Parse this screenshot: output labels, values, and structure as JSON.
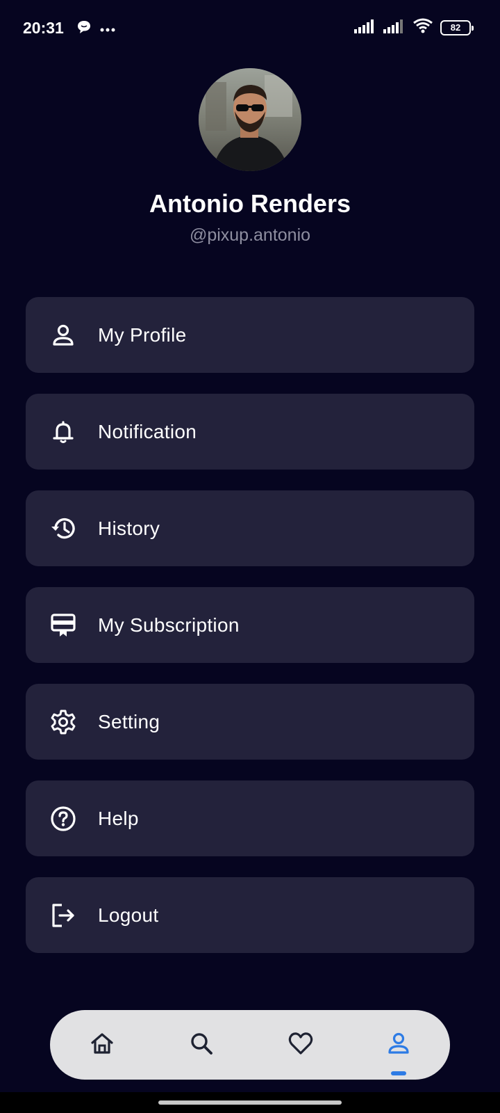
{
  "status_bar": {
    "time": "20:31",
    "battery": "82"
  },
  "profile": {
    "name": "Antonio Renders",
    "handle": "@pixup.antonio"
  },
  "menu": {
    "items": [
      {
        "label": "My Profile",
        "icon": "user-icon"
      },
      {
        "label": "Notification",
        "icon": "bell-icon"
      },
      {
        "label": "History",
        "icon": "history-icon"
      },
      {
        "label": "My Subscription",
        "icon": "subscription-icon"
      },
      {
        "label": "Setting",
        "icon": "gear-icon"
      },
      {
        "label": "Help",
        "icon": "help-icon"
      },
      {
        "label": "Logout",
        "icon": "logout-icon"
      }
    ]
  },
  "bottom_nav": {
    "items": [
      {
        "icon": "home-icon",
        "active": false
      },
      {
        "icon": "search-icon",
        "active": false
      },
      {
        "icon": "heart-icon",
        "active": false
      },
      {
        "icon": "profile-icon",
        "active": true
      }
    ]
  },
  "colors": {
    "background": "#060520",
    "card": "#23223b",
    "accent": "#2d7be5",
    "nav_bg": "#e1e1e3",
    "handle_text": "#8e8ea0"
  }
}
